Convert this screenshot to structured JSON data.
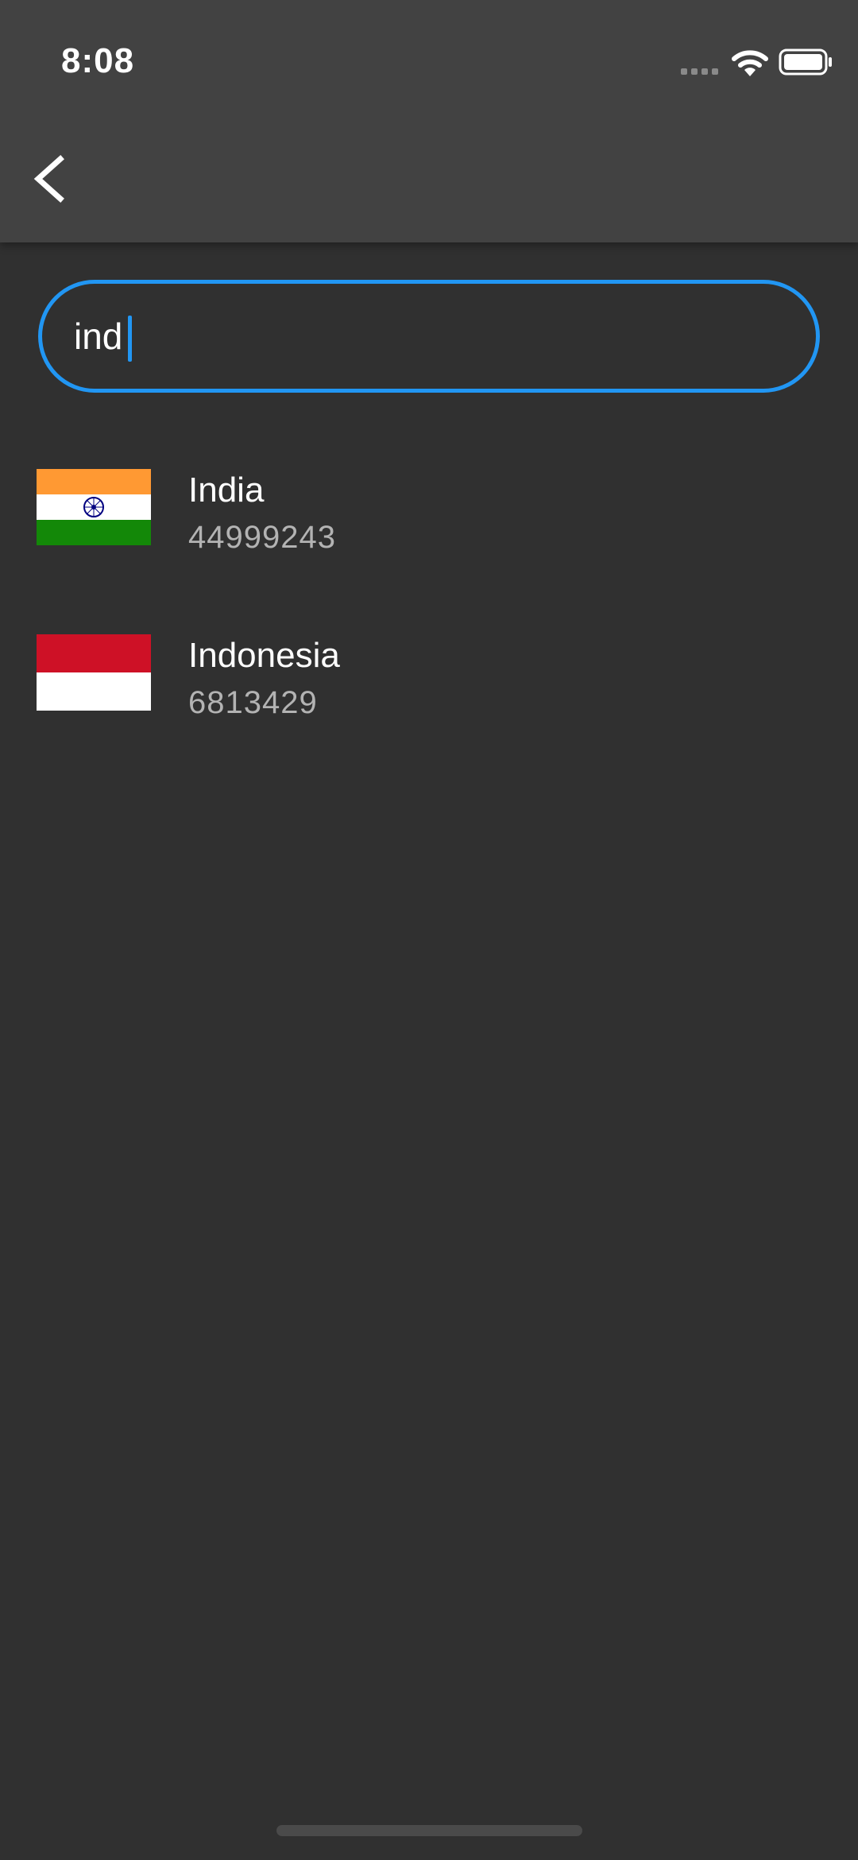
{
  "status_bar": {
    "time": "8:08",
    "icons": [
      "signal-icon",
      "wifi-icon",
      "battery-icon"
    ]
  },
  "app_bar": {
    "back_icon": "chevron-left-icon"
  },
  "search": {
    "value": "ind",
    "accent_color": "#2196f3"
  },
  "results": [
    {
      "name": "India",
      "count": "44999243",
      "flag": "india-flag-icon"
    },
    {
      "name": "Indonesia",
      "count": "6813429",
      "flag": "indonesia-flag-icon"
    }
  ],
  "colors": {
    "background": "#303030",
    "app_bar": "#424242",
    "secondary_text": "#b3b3b3"
  }
}
